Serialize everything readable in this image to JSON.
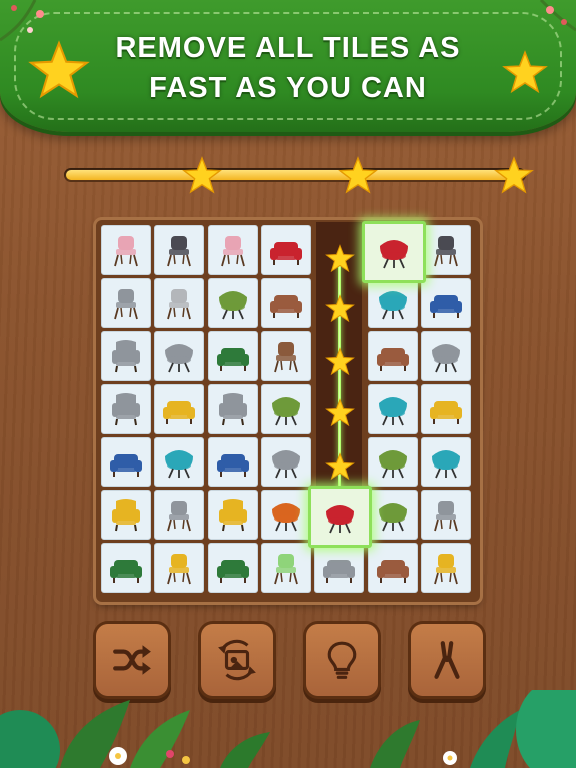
{
  "banner": {
    "line1": "REMOVE ALL TILES AS",
    "line2": "FAST AS YOU CAN"
  },
  "progress": {
    "fill_fraction": 0.97,
    "stars": 3,
    "star_color": "#ffd21f"
  },
  "colors": {
    "banner_green": "#2f8a22",
    "wood": "#8b532d",
    "selected_glow": "#8ee05a"
  },
  "board": {
    "columns": 7,
    "rows": 7,
    "selected_tiles": [
      "r0c5",
      "r5c4"
    ],
    "tiles": [
      [
        "pink-chair",
        "charcoal-chair",
        "pink-chair",
        "red-armchair",
        "empty",
        "red-egg-chair",
        "charcoal-chair"
      ],
      [
        "gray-chair",
        "gray-tweed-chair",
        "green-egg-chair",
        "brown-leather-armchair",
        "empty",
        "teal-egg-chair",
        "blue-armchair"
      ],
      [
        "gray-wingback",
        "gray-tulip-chair",
        "green-club-chair",
        "brown-wood-chair",
        "empty",
        "brown-leather-armchair",
        "gray-tulip-chair"
      ],
      [
        "gray-wingback",
        "yellow-armchair",
        "gray-wingback",
        "green-egg-chair",
        "empty",
        "teal-lounge-chair",
        "yellow-armchair"
      ],
      [
        "blue-armchair",
        "teal-egg-chair",
        "blue-armchair",
        "gray-tulip-chair",
        "empty",
        "green-egg-chair",
        "teal-egg-chair"
      ],
      [
        "yellow-wingback",
        "gray-chair",
        "yellow-wingback",
        "orange-shell-chair",
        "red-egg-chair",
        "green-egg-chair",
        "gray-chair"
      ],
      [
        "green-club-chair",
        "yellow-chair",
        "green-club-chair",
        "mint-chair",
        "gray-sofa",
        "brown-leather-armchair",
        "yellow-chair"
      ]
    ]
  },
  "toolbar": {
    "buttons": [
      {
        "name": "shuffle-button",
        "icon": "shuffle-icon"
      },
      {
        "name": "undo-button",
        "icon": "undo-tile-icon"
      },
      {
        "name": "hint-button",
        "icon": "lightbulb-icon"
      },
      {
        "name": "remove-button",
        "icon": "pliers-icon"
      }
    ]
  }
}
